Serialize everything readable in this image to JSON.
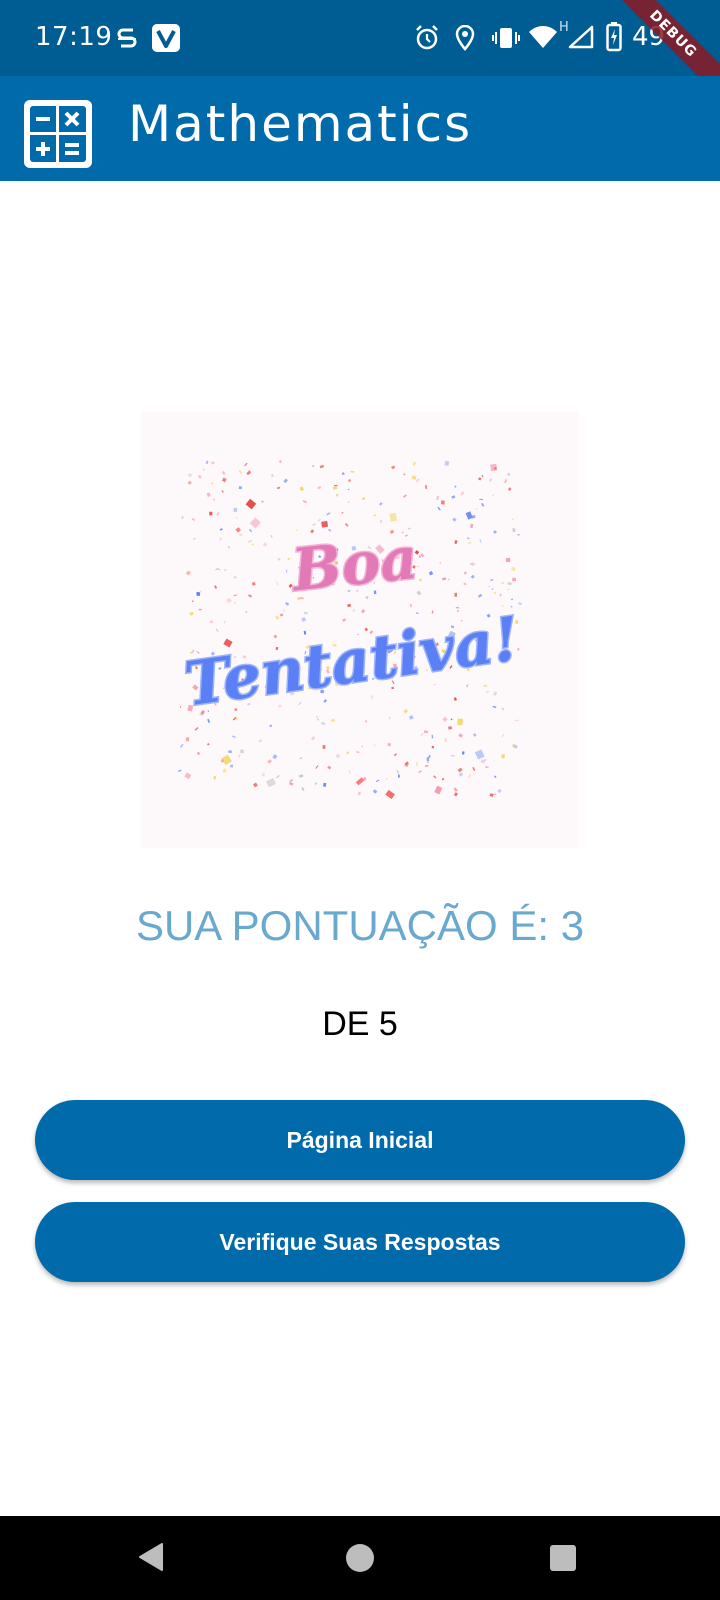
{
  "status_bar": {
    "time": "17:19",
    "battery_percent": "49",
    "network_label": "H",
    "debug_label": "DEBUG",
    "icons": [
      "s-app-icon",
      "v-app-icon",
      "alarm-icon",
      "location-icon",
      "vibrate-icon",
      "wifi-icon",
      "signal-icon",
      "battery-charging-icon"
    ]
  },
  "app_bar": {
    "title": "Mathematics",
    "logo_icon": "calculator-icon"
  },
  "result": {
    "image_text_line1": "Boa",
    "image_text_line2": "Tentativa!",
    "score_label": "SUA PONTUAÇÃO É: 3",
    "total_label": "DE 5"
  },
  "buttons": {
    "home_label": "Página Inicial",
    "verify_label": "Verifique Suas Respostas"
  },
  "nav_bar": {
    "back_icon": "back-triangle-icon",
    "home_icon": "home-circle-icon",
    "recents_icon": "recents-square-icon"
  },
  "colors": {
    "status_bar": "#005d93",
    "app_bar": "#006aab",
    "button": "#006aab",
    "score_text": "#6aa9cf",
    "image_pink": "#e27ab8",
    "image_blue": "#5b80f5"
  }
}
